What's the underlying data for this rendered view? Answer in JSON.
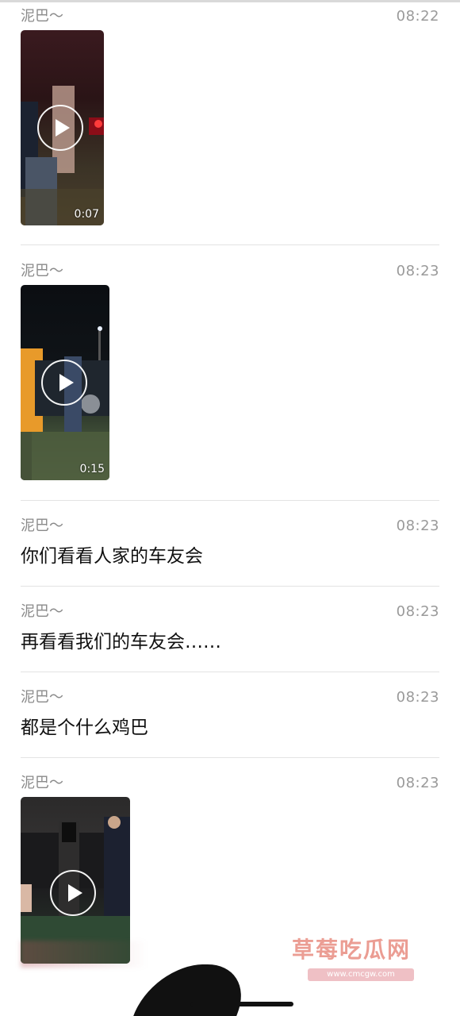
{
  "messages": [
    {
      "sender": "泥巴～",
      "time": "08:22",
      "type": "video",
      "duration": "0:07"
    },
    {
      "sender": "泥巴～",
      "time": "08:23",
      "type": "video",
      "duration": "0:15"
    },
    {
      "sender": "泥巴～",
      "time": "08:23",
      "type": "text",
      "text": "你们看看人家的车友会"
    },
    {
      "sender": "泥巴～",
      "time": "08:23",
      "type": "text",
      "text": "再看看我们的车友会……"
    },
    {
      "sender": "泥巴～",
      "time": "08:23",
      "type": "text",
      "text": "都是个什么鸡巴"
    },
    {
      "sender": "泥巴～",
      "time": "08:23",
      "type": "video",
      "duration": ""
    }
  ],
  "watermark": {
    "title": "草莓吃瓜网",
    "url": "www.cmcgw.com"
  },
  "colors": {
    "meta_text": "#8a8a8a",
    "divider": "#e3e3e3",
    "body_text": "#111111"
  },
  "icons": {
    "play": "play-icon"
  }
}
